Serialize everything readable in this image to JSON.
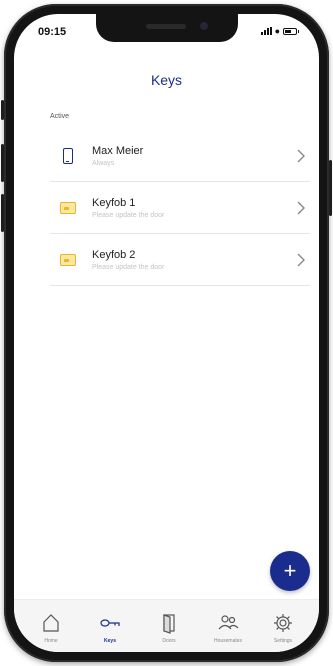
{
  "status_bar": {
    "time": "09:15"
  },
  "header": {
    "title": "Keys"
  },
  "section": {
    "label": "Active"
  },
  "keys": [
    {
      "title": "Max Meier",
      "subtitle": "Always",
      "icon": "smartphone-icon"
    },
    {
      "title": "Keyfob 1",
      "subtitle": "Please update the door",
      "icon": "keyfob-icon"
    },
    {
      "title": "Keyfob 2",
      "subtitle": "Please update the door",
      "icon": "keyfob-icon"
    }
  ],
  "fab": {
    "label": "+"
  },
  "tabs": [
    {
      "label": "Home",
      "icon": "home-icon"
    },
    {
      "label": "Keys",
      "icon": "key-icon",
      "active": true
    },
    {
      "label": "Doors",
      "icon": "door-icon"
    },
    {
      "label": "Housemates",
      "icon": "people-icon"
    },
    {
      "label": "Settings",
      "icon": "gear-icon"
    }
  ],
  "colors": {
    "accent": "#1a2d8f",
    "keyfob": "#e7b722",
    "subtitle": "#c4c4c4",
    "tabbar": "#f5f5f5"
  }
}
